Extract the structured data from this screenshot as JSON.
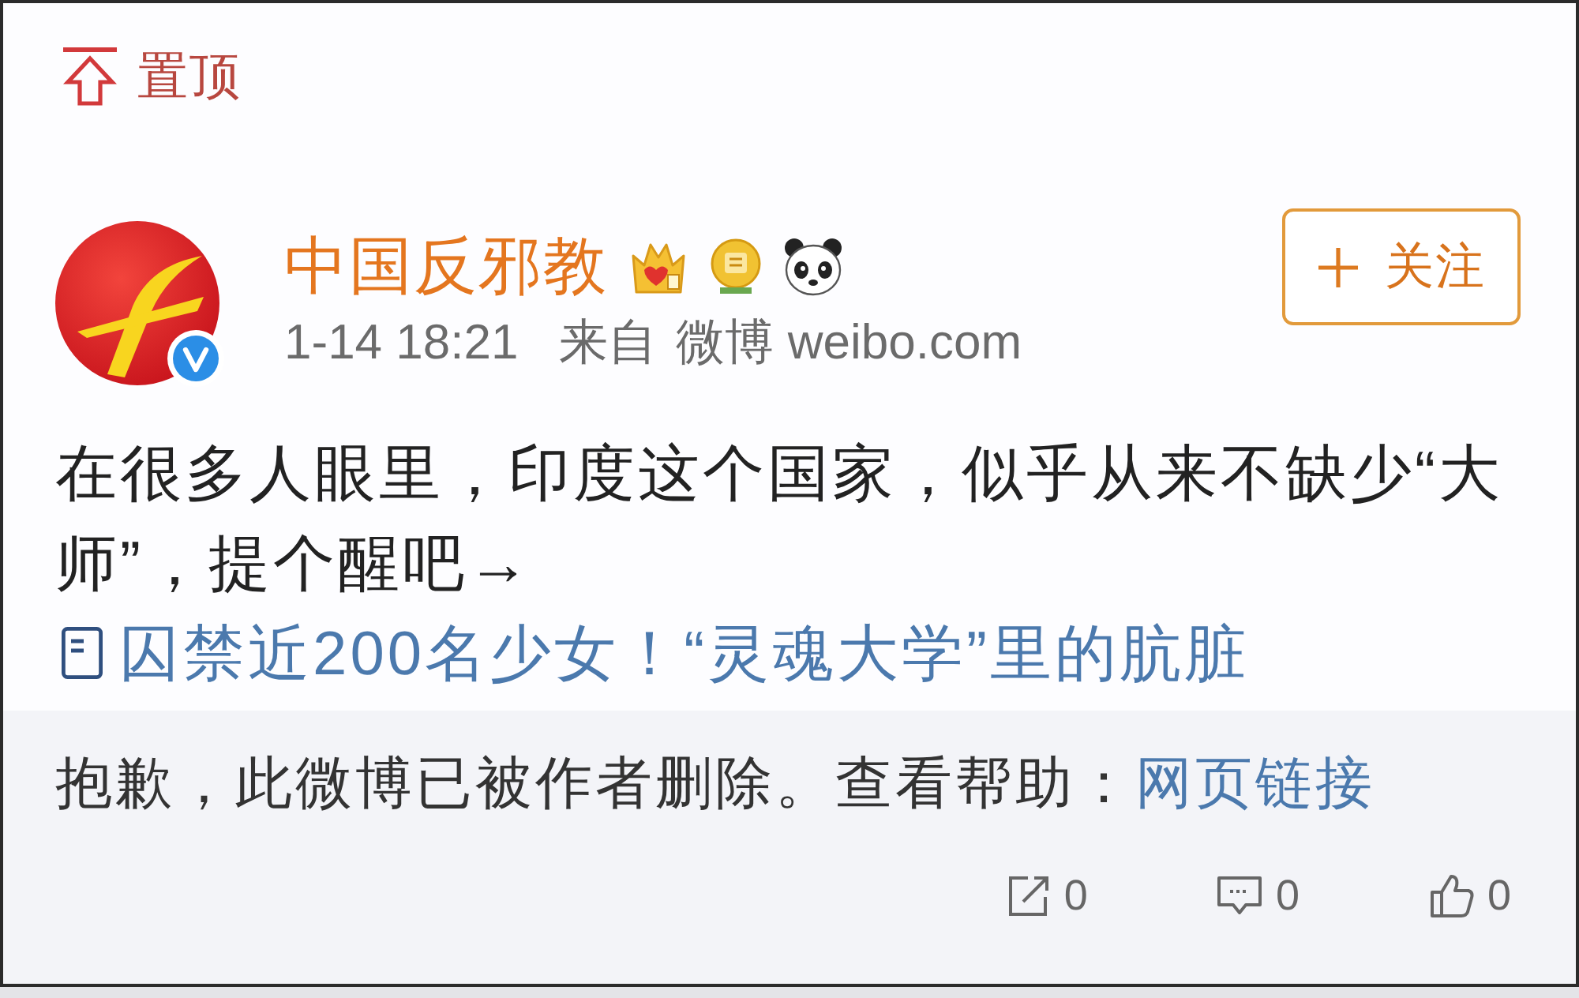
{
  "pinned": {
    "label": "置顶"
  },
  "post": {
    "author": {
      "name": "中国反邪教",
      "verified": true
    },
    "time": "1-14 18:21",
    "source_prefix": "来自",
    "source": "微博 weibo.com",
    "follow_button": {
      "label": "关注"
    },
    "text": "在很多人眼里，印度这个国家，似乎从来不缺少“大师”，提个醒吧→",
    "link": "囚禁近200名少女！“灵魂大学”里的肮脏"
  },
  "deleted_notice": {
    "text": "抱歉，此微博已被作者删除。查看帮助：",
    "link": "网页链接"
  },
  "actions": [
    {
      "kind": "repost",
      "count": "0"
    },
    {
      "kind": "comment",
      "count": "0"
    },
    {
      "kind": "like",
      "count": "0"
    }
  ]
}
